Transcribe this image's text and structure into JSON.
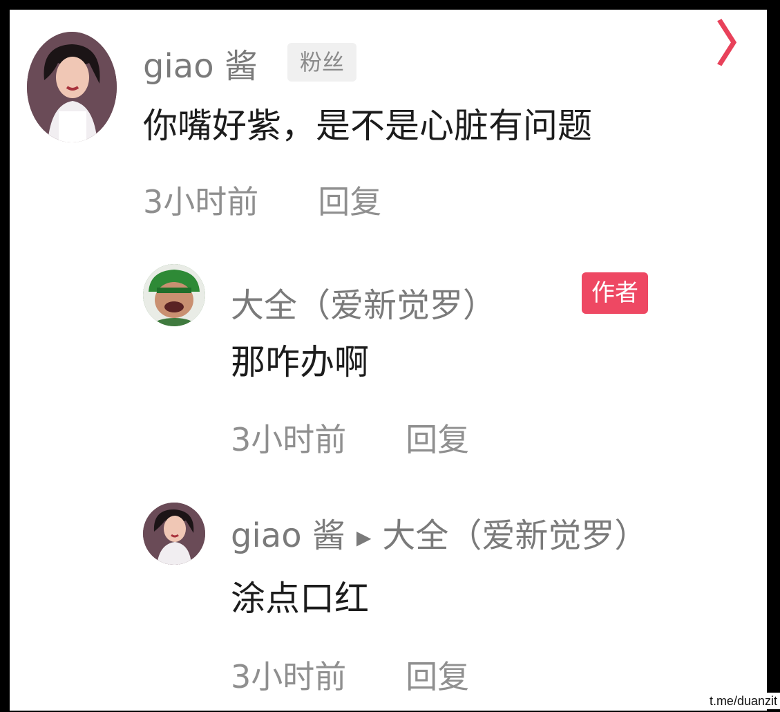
{
  "comment": {
    "username": "giao 酱",
    "fan_badge": "粉丝",
    "text": "你嘴好紫，是不是心脏有问题",
    "time": "3小时前",
    "reply_label": "回复"
  },
  "replies": [
    {
      "username": "大全（爱新觉罗）",
      "author_badge": "作者",
      "text": "那咋办啊",
      "time": "3小时前",
      "reply_label": "回复"
    },
    {
      "username": "giao 酱",
      "reply_to": "大全（爱新觉罗）",
      "text": "涂点口红",
      "time": "3小时前",
      "reply_label": "回复"
    }
  ],
  "corner_glyph": "〉",
  "watermark": "t.me/duanzit",
  "colors": {
    "author_badge": "#ee4863",
    "background": "#ffffff",
    "text": "#1c1c1c",
    "meta": "#8f8f8f"
  },
  "icons": [
    "avatar-girl",
    "avatar-man-green-hat",
    "reply-arrow-icon"
  ]
}
